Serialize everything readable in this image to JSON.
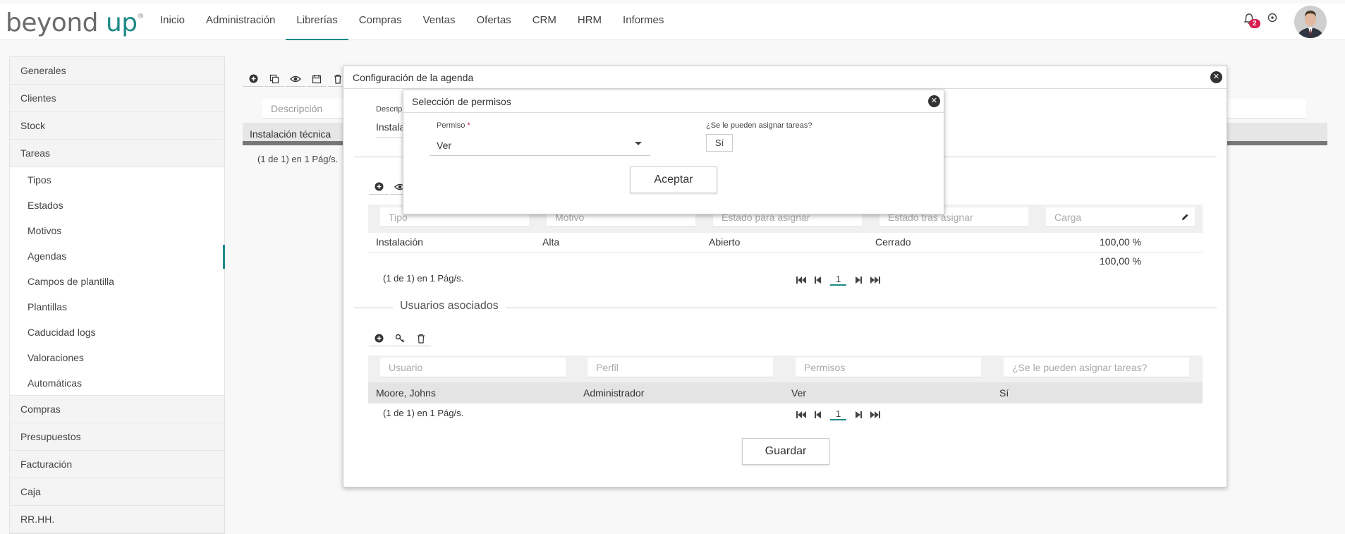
{
  "header": {
    "logo_word1": "beyond",
    "logo_word2": "up",
    "logo_reg": "®",
    "nav": [
      "Inicio",
      "Administración",
      "Librerías",
      "Compras",
      "Ventas",
      "Ofertas",
      "CRM",
      "HRM",
      "Informes"
    ],
    "active_nav": "Librerías",
    "notifications_count": "2",
    "icons": {
      "bell": "bell-icon",
      "power": "power-icon"
    }
  },
  "sidebar": {
    "groups_top": [
      "Generales",
      "Clientes",
      "Stock",
      "Tareas"
    ],
    "tareas_items": [
      "Tipos",
      "Estados",
      "Motivos",
      "Agendas",
      "Campos de plantilla",
      "Plantillas",
      "Caducidad logs",
      "Valoraciones",
      "Automáticas"
    ],
    "active_item": "Agendas",
    "groups_bottom": [
      "Compras",
      "Presupuestos",
      "Facturación",
      "Caja",
      "RR.HH."
    ]
  },
  "background_list": {
    "filter_placeholder": "Descripción",
    "row": "Instalación técnica",
    "pages": "(1 de 1) en 1 Pág/s."
  },
  "dialog": {
    "title": "Configuración de la agenda",
    "desc_label": "Descrip",
    "desc_value": "Instala",
    "tasks_filters": [
      "Tipo",
      "Motivo",
      "Estado para asignar",
      "Estado tras asignar",
      "Carga"
    ],
    "tasks_row": {
      "tipo": "Instalación",
      "motivo": "Alta",
      "estado_asignar": "Abierto",
      "estado_tras": "Cerrado",
      "carga": "100,00 %"
    },
    "tasks_total": "100,00 %",
    "tasks_pages": "(1 de 1) en 1 Pág/s.",
    "page_number": "1",
    "users_section_title": "Usuarios asociados",
    "users_filters": [
      "Usuario",
      "Perfil",
      "Permisos",
      "¿Se le pueden asignar tareas?"
    ],
    "users_row": {
      "usuario": "Moore, Johns",
      "perfil": "Administrador",
      "permisos": "Ver",
      "asignar": "Sí"
    },
    "users_pages": "(1 de 1) en 1 Pág/s.",
    "save_label": "Guardar"
  },
  "permissions_dialog": {
    "title": "Selección de permisos",
    "permiso_label": "Permiso",
    "required_mark": "*",
    "permiso_value": "Ver",
    "assign_label": "¿Se le pueden asignar tareas?",
    "assign_value": "Sí",
    "accept_label": "Aceptar"
  }
}
